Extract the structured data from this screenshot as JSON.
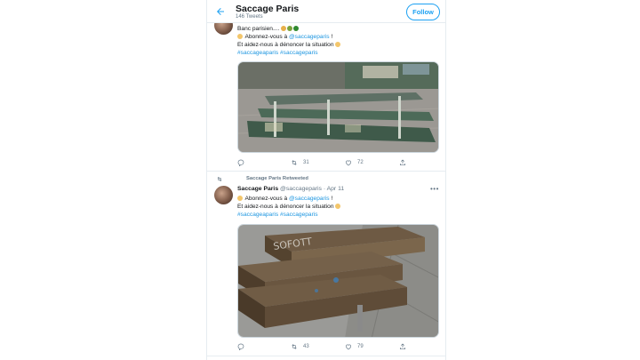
{
  "header": {
    "title": "Saccage Paris",
    "subtitle": "146 Tweets",
    "follow_label": "Follow"
  },
  "tweet1": {
    "lines": [
      {
        "pre": "Banc parisien....",
        "emojis": [
          "#e8b04a",
          "#7aa23a",
          "#2f8a2f"
        ]
      },
      {
        "pre": "Abonnez-vous à ",
        "link": "@saccageparis",
        "post": " !"
      },
      {
        "pre": "Et aidez-nous à dénoncer la situation"
      },
      {
        "link": "#saccageaparis #saccageparis"
      }
    ],
    "retweets": "31",
    "likes": "72"
  },
  "retweet_label": "Saccage Paris Retweeted",
  "tweet2": {
    "name": "Saccage Paris",
    "handle_time": "@saccageparis · Apr 11",
    "lines": [
      {
        "pre": "Abonnez-vous à ",
        "link": "@saccageparis",
        "post": " !"
      },
      {
        "pre": "Et aidez-nous à dénoncer la situation"
      },
      {
        "link": "#saccageaparis #saccageparis"
      }
    ],
    "retweets": "43",
    "likes": "79"
  },
  "colors": {
    "accent": "#1da1f2",
    "link": "#1b95e0",
    "secondary_text": "#657786",
    "divider": "#e6ecf0"
  },
  "icons": [
    "back-arrow-icon",
    "reply-icon",
    "retweet-icon",
    "like-icon",
    "share-icon",
    "more-icon"
  ]
}
